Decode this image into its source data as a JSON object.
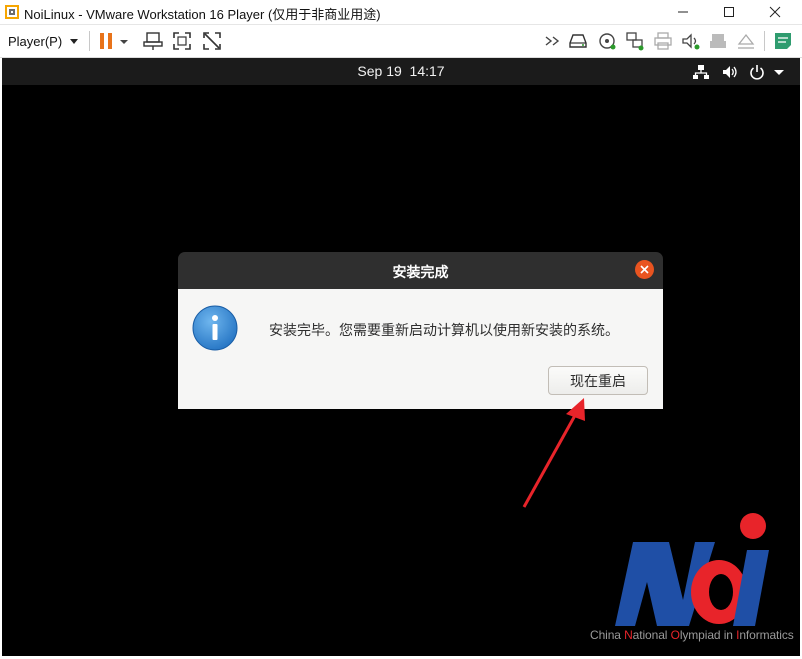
{
  "window": {
    "title": "NoiLinux - VMware Workstation 16 Player (仅用于非商业用途)",
    "app_icon": "vmware-icon",
    "controls": [
      "minimize-icon",
      "maximize-icon",
      "close-icon"
    ]
  },
  "toolbar": {
    "player_menu_label": "Player(P)",
    "left_icons": [
      "pause-icon",
      "send-ctrl-alt-del-icon",
      "fullscreen-icon",
      "unity-icon"
    ],
    "right_icons": [
      "expand-icon",
      "hard-disk-icon",
      "cd-dvd-icon",
      "network-adapter-icon",
      "printer-icon",
      "sound-card-icon",
      "usb-controller-icon",
      "display-icon",
      "message-log-icon"
    ]
  },
  "guest": {
    "top_bar": {
      "date": "Sep 19",
      "time": "14:17",
      "tray_icons": [
        "network-wired-icon",
        "volume-icon",
        "power-icon",
        "menu-arrow-icon"
      ]
    },
    "dialog": {
      "title": "安装完成",
      "message": "安装完毕。您需要重新启动计算机以使用新安装的系统。",
      "restart_button_label": "现在重启",
      "icon": "info-icon",
      "accent_color": "#e95420"
    },
    "annotation": {
      "arrow_color": "#e8242a"
    },
    "watermark": {
      "logo_text": "NOi",
      "caption_parts": [
        "China ",
        "N",
        "ational ",
        "O",
        "lympiad in ",
        "I",
        "nformatics"
      ]
    }
  }
}
